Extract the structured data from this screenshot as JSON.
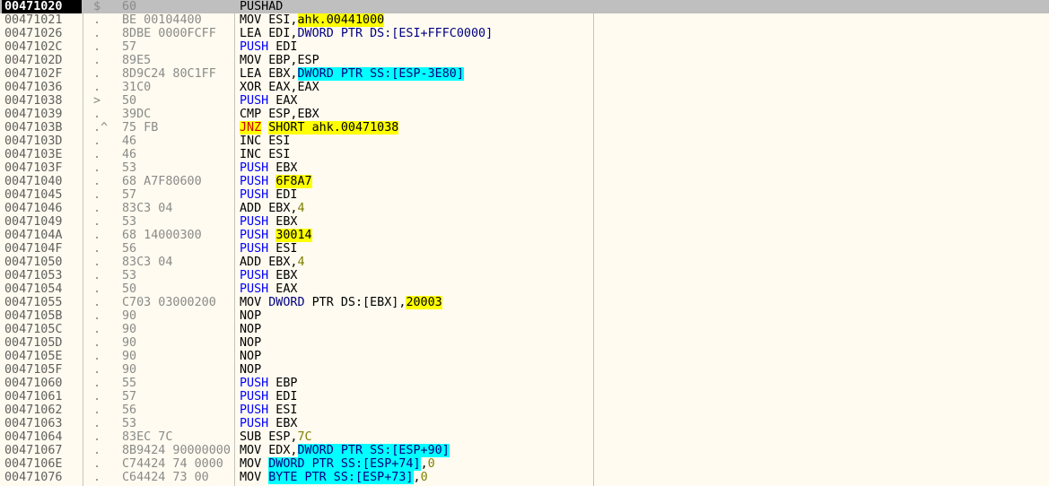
{
  "rows": [
    {
      "addr": "00471020",
      "mark": "$",
      "hex": "60",
      "asm": [
        {
          "t": "PUSHAD",
          "c": "mn"
        }
      ],
      "selected": true
    },
    {
      "addr": "00471021",
      "mark": ".",
      "hex": "BE 00104400",
      "asm": [
        {
          "t": "MOV",
          "c": "mn"
        },
        {
          "t": " ESI,",
          "c": "op"
        },
        {
          "t": "ahk.00441000",
          "c": "yl"
        }
      ]
    },
    {
      "addr": "00471026",
      "mark": ".",
      "hex": "8DBE 0000FCFF",
      "asm": [
        {
          "t": "LEA",
          "c": "mn"
        },
        {
          "t": " EDI,",
          "c": "op"
        },
        {
          "t": "DWORD",
          "c": "dword"
        },
        {
          "t": " PTR DS:[ESI+FFFC0000]",
          "c": "cy-op"
        }
      ]
    },
    {
      "addr": "0047102C",
      "mark": ".",
      "hex": "57",
      "asm": [
        {
          "t": "PUSH",
          "c": "mn push"
        },
        {
          "t": " EDI",
          "c": "op"
        }
      ]
    },
    {
      "addr": "0047102D",
      "mark": ".",
      "hex": "89E5",
      "asm": [
        {
          "t": "MOV",
          "c": "mn"
        },
        {
          "t": " EBP,ESP",
          "c": "op"
        }
      ]
    },
    {
      "addr": "0047102F",
      "mark": ".",
      "hex": "8D9C24 80C1FF",
      "asm": [
        {
          "t": "LEA",
          "c": "mn"
        },
        {
          "t": " EBX,",
          "c": "op"
        },
        {
          "t": "DWORD PTR SS:[ESP-3E80]",
          "c": "cy cy-op"
        }
      ]
    },
    {
      "addr": "00471036",
      "mark": ".",
      "hex": "31C0",
      "asm": [
        {
          "t": "XOR",
          "c": "mn"
        },
        {
          "t": " EAX,EAX",
          "c": "op"
        }
      ]
    },
    {
      "addr": "00471038",
      "mark": ">",
      "hex": "50",
      "asm": [
        {
          "t": "PUSH",
          "c": "mn push"
        },
        {
          "t": " EAX",
          "c": "op"
        }
      ]
    },
    {
      "addr": "00471039",
      "mark": ".",
      "hex": "39DC",
      "asm": [
        {
          "t": "CMP",
          "c": "mn"
        },
        {
          "t": " ESP,EBX",
          "c": "op"
        }
      ]
    },
    {
      "addr": "0047103B",
      "mark": ".^",
      "hex": "75 FB",
      "asm": [
        {
          "t": "JNZ",
          "c": "mn jmp"
        },
        {
          "t": " ",
          "c": "op"
        },
        {
          "t": "SHORT ahk.00471038",
          "c": "yl"
        }
      ]
    },
    {
      "addr": "0047103D",
      "mark": ".",
      "hex": "46",
      "asm": [
        {
          "t": "INC",
          "c": "mn"
        },
        {
          "t": " ESI",
          "c": "op"
        }
      ]
    },
    {
      "addr": "0047103E",
      "mark": ".",
      "hex": "46",
      "asm": [
        {
          "t": "INC",
          "c": "mn"
        },
        {
          "t": " ESI",
          "c": "op"
        }
      ]
    },
    {
      "addr": "0047103F",
      "mark": ".",
      "hex": "53",
      "asm": [
        {
          "t": "PUSH",
          "c": "mn push"
        },
        {
          "t": " EBX",
          "c": "op"
        }
      ]
    },
    {
      "addr": "00471040",
      "mark": ".",
      "hex": "68 A7F80600",
      "asm": [
        {
          "t": "PUSH",
          "c": "mn push"
        },
        {
          "t": " ",
          "c": "op"
        },
        {
          "t": "6F8A7",
          "c": "yl"
        }
      ]
    },
    {
      "addr": "00471045",
      "mark": ".",
      "hex": "57",
      "asm": [
        {
          "t": "PUSH",
          "c": "mn push"
        },
        {
          "t": " EDI",
          "c": "op"
        }
      ]
    },
    {
      "addr": "00471046",
      "mark": ".",
      "hex": "83C3 04",
      "asm": [
        {
          "t": "ADD",
          "c": "mn"
        },
        {
          "t": " EBX,",
          "c": "op"
        },
        {
          "t": "4",
          "c": "num"
        }
      ]
    },
    {
      "addr": "00471049",
      "mark": ".",
      "hex": "53",
      "asm": [
        {
          "t": "PUSH",
          "c": "mn push"
        },
        {
          "t": " EBX",
          "c": "op"
        }
      ]
    },
    {
      "addr": "0047104A",
      "mark": ".",
      "hex": "68 14000300",
      "asm": [
        {
          "t": "PUSH",
          "c": "mn push"
        },
        {
          "t": " ",
          "c": "op"
        },
        {
          "t": "30014",
          "c": "yl"
        }
      ]
    },
    {
      "addr": "0047104F",
      "mark": ".",
      "hex": "56",
      "asm": [
        {
          "t": "PUSH",
          "c": "mn push"
        },
        {
          "t": " ESI",
          "c": "op"
        }
      ]
    },
    {
      "addr": "00471050",
      "mark": ".",
      "hex": "83C3 04",
      "asm": [
        {
          "t": "ADD",
          "c": "mn"
        },
        {
          "t": " EBX,",
          "c": "op"
        },
        {
          "t": "4",
          "c": "num"
        }
      ]
    },
    {
      "addr": "00471053",
      "mark": ".",
      "hex": "53",
      "asm": [
        {
          "t": "PUSH",
          "c": "mn push"
        },
        {
          "t": " EBX",
          "c": "op"
        }
      ]
    },
    {
      "addr": "00471054",
      "mark": ".",
      "hex": "50",
      "asm": [
        {
          "t": "PUSH",
          "c": "mn push"
        },
        {
          "t": " EAX",
          "c": "op"
        }
      ]
    },
    {
      "addr": "00471055",
      "mark": ".",
      "hex": "C703 03000200",
      "asm": [
        {
          "t": "MOV",
          "c": "mn"
        },
        {
          "t": " ",
          "c": "op"
        },
        {
          "t": "DWORD",
          "c": "dword"
        },
        {
          "t": " PTR DS:[EBX],",
          "c": "op"
        },
        {
          "t": "20003",
          "c": "yl"
        }
      ]
    },
    {
      "addr": "0047105B",
      "mark": ".",
      "hex": "90",
      "asm": [
        {
          "t": "NOP",
          "c": "mn"
        }
      ]
    },
    {
      "addr": "0047105C",
      "mark": ".",
      "hex": "90",
      "asm": [
        {
          "t": "NOP",
          "c": "mn"
        }
      ]
    },
    {
      "addr": "0047105D",
      "mark": ".",
      "hex": "90",
      "asm": [
        {
          "t": "NOP",
          "c": "mn"
        }
      ]
    },
    {
      "addr": "0047105E",
      "mark": ".",
      "hex": "90",
      "asm": [
        {
          "t": "NOP",
          "c": "mn"
        }
      ]
    },
    {
      "addr": "0047105F",
      "mark": ".",
      "hex": "90",
      "asm": [
        {
          "t": "NOP",
          "c": "mn"
        }
      ]
    },
    {
      "addr": "00471060",
      "mark": ".",
      "hex": "55",
      "asm": [
        {
          "t": "PUSH",
          "c": "mn push"
        },
        {
          "t": " EBP",
          "c": "op"
        }
      ]
    },
    {
      "addr": "00471061",
      "mark": ".",
      "hex": "57",
      "asm": [
        {
          "t": "PUSH",
          "c": "mn push"
        },
        {
          "t": " EDI",
          "c": "op"
        }
      ]
    },
    {
      "addr": "00471062",
      "mark": ".",
      "hex": "56",
      "asm": [
        {
          "t": "PUSH",
          "c": "mn push"
        },
        {
          "t": " ESI",
          "c": "op"
        }
      ]
    },
    {
      "addr": "00471063",
      "mark": ".",
      "hex": "53",
      "asm": [
        {
          "t": "PUSH",
          "c": "mn push"
        },
        {
          "t": " EBX",
          "c": "op"
        }
      ]
    },
    {
      "addr": "00471064",
      "mark": ".",
      "hex": "83EC 7C",
      "asm": [
        {
          "t": "SUB",
          "c": "mn"
        },
        {
          "t": " ESP,",
          "c": "op"
        },
        {
          "t": "7C",
          "c": "num"
        }
      ]
    },
    {
      "addr": "00471067",
      "mark": ".",
      "hex": "8B9424 90000000",
      "asm": [
        {
          "t": "MOV",
          "c": "mn"
        },
        {
          "t": " EDX,",
          "c": "op"
        },
        {
          "t": "DWORD PTR SS:[ESP+90]",
          "c": "cy cy-op"
        }
      ]
    },
    {
      "addr": "0047106E",
      "mark": ".",
      "hex": "C74424 74 0000",
      "asm": [
        {
          "t": "MOV",
          "c": "mn"
        },
        {
          "t": " ",
          "c": "op"
        },
        {
          "t": "DWORD PTR SS:[ESP+74]",
          "c": "cy cy-op"
        },
        {
          "t": ",",
          "c": "op"
        },
        {
          "t": "0",
          "c": "num"
        }
      ]
    },
    {
      "addr": "00471076",
      "mark": ".",
      "hex": "C64424 73 00",
      "asm": [
        {
          "t": "MOV",
          "c": "mn"
        },
        {
          "t": " ",
          "c": "op"
        },
        {
          "t": "BYTE PTR SS:[ESP+73]",
          "c": "cy cy-op"
        },
        {
          "t": ",",
          "c": "op"
        },
        {
          "t": "0",
          "c": "num"
        }
      ]
    }
  ]
}
